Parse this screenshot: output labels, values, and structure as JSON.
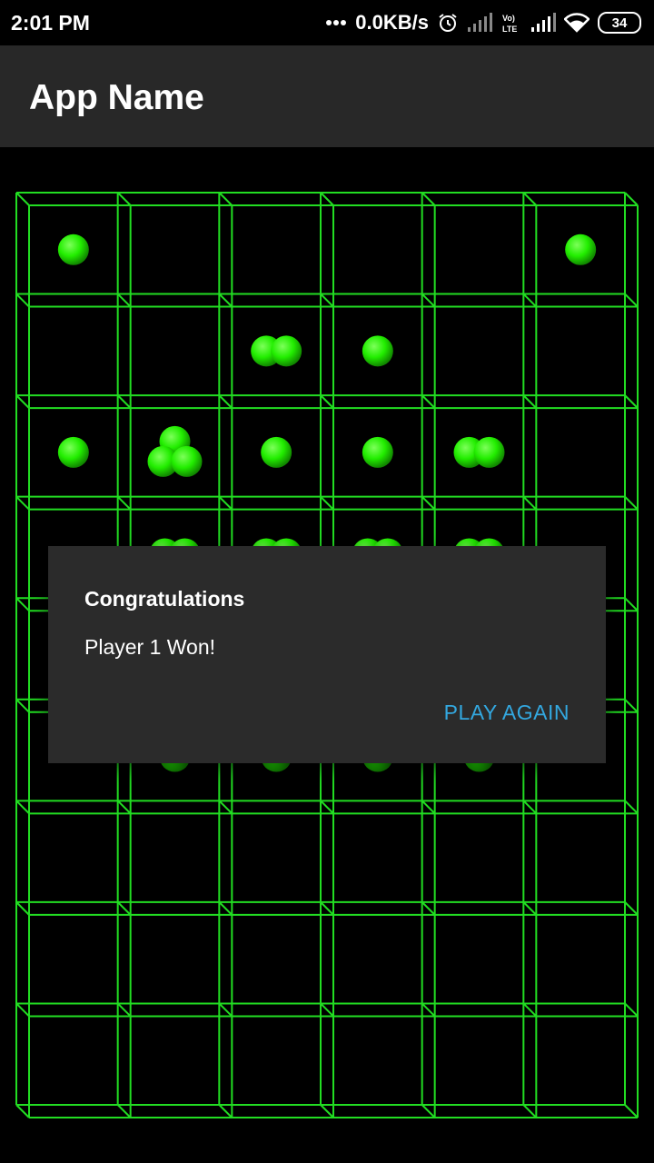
{
  "status_bar": {
    "time": "2:01 PM",
    "network_speed": "0.0KB/s",
    "battery_level": "34",
    "icons": [
      "dots-icon",
      "alarm-icon",
      "signal-icon",
      "volte-icon",
      "signal-icon",
      "wifi-icon",
      "battery-icon"
    ]
  },
  "app_bar": {
    "title": "App Name"
  },
  "board": {
    "columns": 6,
    "rows": 9,
    "line_color": "#22dd22",
    "orb_color": "#22ee00",
    "cells": [
      {
        "row": 0,
        "col": 0,
        "count": 1
      },
      {
        "row": 0,
        "col": 5,
        "count": 1
      },
      {
        "row": 1,
        "col": 2,
        "count": 2
      },
      {
        "row": 1,
        "col": 3,
        "count": 1
      },
      {
        "row": 2,
        "col": 0,
        "count": 1
      },
      {
        "row": 2,
        "col": 1,
        "count": 3
      },
      {
        "row": 2,
        "col": 2,
        "count": 1
      },
      {
        "row": 2,
        "col": 3,
        "count": 1
      },
      {
        "row": 2,
        "col": 4,
        "count": 2
      },
      {
        "row": 3,
        "col": 1,
        "count": 2
      },
      {
        "row": 3,
        "col": 2,
        "count": 2
      },
      {
        "row": 3,
        "col": 3,
        "count": 2
      },
      {
        "row": 3,
        "col": 4,
        "count": 2
      },
      {
        "row": 5,
        "col": 1,
        "count": 1
      },
      {
        "row": 5,
        "col": 2,
        "count": 1
      },
      {
        "row": 5,
        "col": 3,
        "count": 1
      },
      {
        "row": 5,
        "col": 4,
        "count": 1
      }
    ]
  },
  "dialog": {
    "title": "Congratulations",
    "message": "Player 1 Won!",
    "button_label": "PLAY AGAIN",
    "button_color": "#33a8e0"
  }
}
